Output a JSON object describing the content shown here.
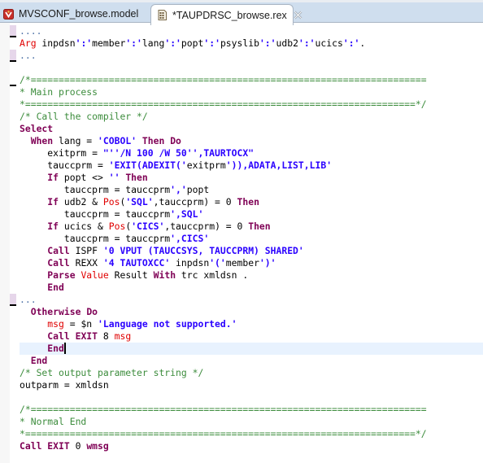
{
  "tabs": [
    {
      "label": "MVSCONF_browse.model",
      "icon": "model-file-icon",
      "active": false
    },
    {
      "label": "*TAUPDRSC_browse.rex",
      "icon": "rexx-file-icon",
      "active": true,
      "closable": true
    }
  ],
  "colors": {
    "keyword": "#7f0055",
    "builtin": "#e00000",
    "string": "#2a00ff",
    "comment": "#3c8c3c",
    "current_line": "#e8f2fe",
    "tab_bar": "#cfdeee"
  },
  "editor": {
    "current_line_index": 26,
    "caret_after_token": true,
    "lines": [
      {
        "fold": "collapsed",
        "tokens": [
          {
            "t": "....",
            "c": "fold"
          }
        ]
      },
      {
        "tokens": [
          {
            "t": "Arg",
            "c": "fn"
          },
          {
            "t": " inpdsn",
            "c": "plain"
          },
          {
            "t": "':'",
            "c": "str"
          },
          {
            "t": "member",
            "c": "plain"
          },
          {
            "t": "':'",
            "c": "str"
          },
          {
            "t": "lang",
            "c": "plain"
          },
          {
            "t": "':'",
            "c": "str"
          },
          {
            "t": "popt",
            "c": "plain"
          },
          {
            "t": "':'",
            "c": "str"
          },
          {
            "t": "psyslib",
            "c": "plain"
          },
          {
            "t": "':'",
            "c": "str"
          },
          {
            "t": "udb2",
            "c": "plain"
          },
          {
            "t": "':'",
            "c": "str"
          },
          {
            "t": "ucics",
            "c": "plain"
          },
          {
            "t": "':'",
            "c": "str"
          },
          {
            "t": ".",
            "c": "plain"
          }
        ]
      },
      {
        "fold": "collapsed",
        "tokens": [
          {
            "t": "...",
            "c": "fold"
          }
        ]
      },
      {
        "tokens": []
      },
      {
        "fold": "expanded",
        "tokens": [
          {
            "t": "/*=======================================================================",
            "c": "cmt"
          }
        ]
      },
      {
        "tokens": [
          {
            "t": "* Main process",
            "c": "cmt"
          }
        ]
      },
      {
        "tokens": [
          {
            "t": "*======================================================================*/",
            "c": "cmt"
          }
        ]
      },
      {
        "tokens": [
          {
            "t": "/* Call the compiler */",
            "c": "cmt"
          }
        ]
      },
      {
        "tokens": [
          {
            "t": "Select",
            "c": "kw"
          }
        ]
      },
      {
        "tokens": [
          {
            "t": "  ",
            "c": "plain"
          },
          {
            "t": "When",
            "c": "kw"
          },
          {
            "t": " lang = ",
            "c": "plain"
          },
          {
            "t": "'COBOL'",
            "c": "str"
          },
          {
            "t": " ",
            "c": "plain"
          },
          {
            "t": "Then",
            "c": "kw"
          },
          {
            "t": " ",
            "c": "plain"
          },
          {
            "t": "Do",
            "c": "kw"
          }
        ]
      },
      {
        "tokens": [
          {
            "t": "     exitprm = ",
            "c": "plain"
          },
          {
            "t": "\"''/N 100 /W 50'',TAURTOCX\"",
            "c": "str"
          }
        ]
      },
      {
        "tokens": [
          {
            "t": "     tauccprm = ",
            "c": "plain"
          },
          {
            "t": "'EXIT(ADEXIT('",
            "c": "str"
          },
          {
            "t": "exitprm",
            "c": "plain"
          },
          {
            "t": "')),ADATA,LIST,LIB'",
            "c": "str"
          }
        ]
      },
      {
        "tokens": [
          {
            "t": "     ",
            "c": "plain"
          },
          {
            "t": "If",
            "c": "kw"
          },
          {
            "t": " popt <> ",
            "c": "plain"
          },
          {
            "t": "''",
            "c": "str"
          },
          {
            "t": " ",
            "c": "plain"
          },
          {
            "t": "Then",
            "c": "kw"
          }
        ]
      },
      {
        "tokens": [
          {
            "t": "        tauccprm = tauccprm",
            "c": "plain"
          },
          {
            "t": "','",
            "c": "str"
          },
          {
            "t": "popt",
            "c": "plain"
          }
        ]
      },
      {
        "tokens": [
          {
            "t": "     ",
            "c": "plain"
          },
          {
            "t": "If",
            "c": "kw"
          },
          {
            "t": " udb2 & ",
            "c": "plain"
          },
          {
            "t": "Pos",
            "c": "fn"
          },
          {
            "t": "(",
            "c": "plain"
          },
          {
            "t": "'SQL'",
            "c": "str"
          },
          {
            "t": ",tauccprm) = 0 ",
            "c": "plain"
          },
          {
            "t": "Then",
            "c": "kw"
          }
        ]
      },
      {
        "tokens": [
          {
            "t": "        tauccprm = tauccprm",
            "c": "plain"
          },
          {
            "t": "',SQL'",
            "c": "str"
          }
        ]
      },
      {
        "tokens": [
          {
            "t": "     ",
            "c": "plain"
          },
          {
            "t": "If",
            "c": "kw"
          },
          {
            "t": " ucics & ",
            "c": "plain"
          },
          {
            "t": "Pos",
            "c": "fn"
          },
          {
            "t": "(",
            "c": "plain"
          },
          {
            "t": "'CICS'",
            "c": "str"
          },
          {
            "t": ",tauccprm) = 0 ",
            "c": "plain"
          },
          {
            "t": "Then",
            "c": "kw"
          }
        ]
      },
      {
        "tokens": [
          {
            "t": "        tauccprm = tauccprm",
            "c": "plain"
          },
          {
            "t": "',CICS'",
            "c": "str"
          }
        ]
      },
      {
        "tokens": [
          {
            "t": "     ",
            "c": "plain"
          },
          {
            "t": "Call",
            "c": "kw"
          },
          {
            "t": " ISPF ",
            "c": "plain"
          },
          {
            "t": "'0 VPUT (TAUCCSYS, TAUCCPRM) SHARED'",
            "c": "str"
          }
        ]
      },
      {
        "tokens": [
          {
            "t": "     ",
            "c": "plain"
          },
          {
            "t": "Call",
            "c": "kw"
          },
          {
            "t": " REXX ",
            "c": "plain"
          },
          {
            "t": "'4 TAUTOXCC'",
            "c": "str"
          },
          {
            "t": " inpdsn",
            "c": "plain"
          },
          {
            "t": "'('",
            "c": "str"
          },
          {
            "t": "member",
            "c": "plain"
          },
          {
            "t": "')'",
            "c": "str"
          }
        ]
      },
      {
        "tokens": [
          {
            "t": "     ",
            "c": "plain"
          },
          {
            "t": "Parse",
            "c": "kw"
          },
          {
            "t": " ",
            "c": "plain"
          },
          {
            "t": "Value",
            "c": "fn"
          },
          {
            "t": " Result ",
            "c": "plain"
          },
          {
            "t": "With",
            "c": "kw"
          },
          {
            "t": " trc xmldsn .",
            "c": "plain"
          }
        ]
      },
      {
        "tokens": [
          {
            "t": "     ",
            "c": "plain"
          },
          {
            "t": "End",
            "c": "kw"
          }
        ]
      },
      {
        "fold": "collapsed",
        "tokens": [
          {
            "t": "...",
            "c": "fold"
          }
        ]
      },
      {
        "tokens": [
          {
            "t": "  ",
            "c": "plain"
          },
          {
            "t": "Otherwise",
            "c": "kw"
          },
          {
            "t": " ",
            "c": "plain"
          },
          {
            "t": "Do",
            "c": "kw"
          }
        ]
      },
      {
        "tokens": [
          {
            "t": "     ",
            "c": "plain"
          },
          {
            "t": "msg",
            "c": "fn"
          },
          {
            "t": " = $n ",
            "c": "plain"
          },
          {
            "t": "'Language not supported.'",
            "c": "str"
          }
        ]
      },
      {
        "tokens": [
          {
            "t": "     ",
            "c": "plain"
          },
          {
            "t": "Call",
            "c": "kw"
          },
          {
            "t": " ",
            "c": "plain"
          },
          {
            "t": "EXIT",
            "c": "kw"
          },
          {
            "t": " 8 ",
            "c": "plain"
          },
          {
            "t": "msg",
            "c": "fn"
          }
        ]
      },
      {
        "tokens": [
          {
            "t": "     ",
            "c": "plain"
          },
          {
            "t": "End",
            "c": "kw"
          }
        ]
      },
      {
        "tokens": [
          {
            "t": "  ",
            "c": "plain"
          },
          {
            "t": "End",
            "c": "kw"
          }
        ]
      },
      {
        "tokens": [
          {
            "t": "/* Set output parameter string */",
            "c": "cmt"
          }
        ]
      },
      {
        "tokens": [
          {
            "t": "outparm = xmldsn",
            "c": "plain"
          }
        ]
      },
      {
        "tokens": []
      },
      {
        "tokens": [
          {
            "t": "/*=======================================================================",
            "c": "cmt"
          }
        ]
      },
      {
        "tokens": [
          {
            "t": "* Normal End",
            "c": "cmt"
          }
        ]
      },
      {
        "tokens": [
          {
            "t": "*======================================================================*/",
            "c": "cmt"
          }
        ]
      },
      {
        "tokens": [
          {
            "t": "Call",
            "c": "kw"
          },
          {
            "t": " ",
            "c": "plain"
          },
          {
            "t": "EXIT",
            "c": "kw"
          },
          {
            "t": " 0 ",
            "c": "plain"
          },
          {
            "t": "wmsg",
            "c": "kw"
          }
        ]
      }
    ]
  }
}
